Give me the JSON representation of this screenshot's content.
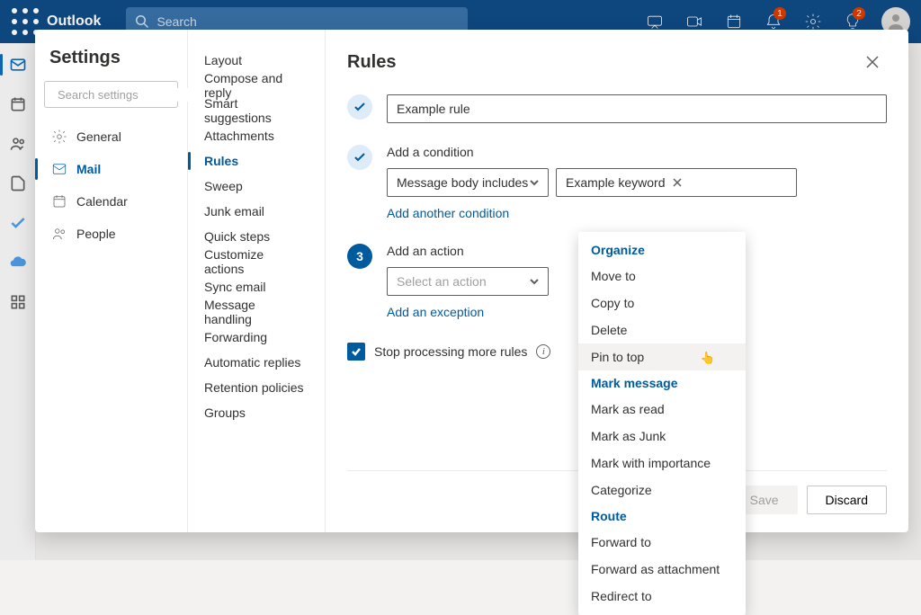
{
  "header": {
    "app_name": "Outlook",
    "search_placeholder": "Search",
    "notification_badge": "1",
    "tips_badge": "2"
  },
  "settings": {
    "title": "Settings",
    "search_placeholder": "Search settings",
    "categories": [
      {
        "label": "General",
        "icon": "gear"
      },
      {
        "label": "Mail",
        "icon": "mail",
        "active": true
      },
      {
        "label": "Calendar",
        "icon": "calendar"
      },
      {
        "label": "People",
        "icon": "people"
      }
    ],
    "subcategories": [
      "Layout",
      "Compose and reply",
      "Smart suggestions",
      "Attachments",
      "Rules",
      "Sweep",
      "Junk email",
      "Quick steps",
      "Customize actions",
      "Sync email",
      "Message handling",
      "Forwarding",
      "Automatic replies",
      "Retention policies",
      "Groups"
    ],
    "active_sub": "Rules"
  },
  "rules": {
    "title": "Rules",
    "name_value": "Example rule",
    "step2_title": "Add a condition",
    "condition_type": "Message body includes",
    "condition_value": "Example keyword",
    "add_condition_link": "Add another condition",
    "step3_title": "Add an action",
    "action_placeholder": "Select an action",
    "add_exception_link": "Add an exception",
    "stop_processing_label": "Stop processing more rules",
    "save_label": "Save",
    "discard_label": "Discard"
  },
  "action_menu": {
    "groups": [
      {
        "header": "Organize",
        "items": [
          "Move to",
          "Copy to",
          "Delete",
          "Pin to top"
        ]
      },
      {
        "header": "Mark message",
        "items": [
          "Mark as read",
          "Mark as Junk",
          "Mark with importance",
          "Categorize"
        ]
      },
      {
        "header": "Route",
        "items": [
          "Forward to",
          "Forward as attachment",
          "Redirect to"
        ]
      }
    ],
    "hovered": "Pin to top"
  }
}
